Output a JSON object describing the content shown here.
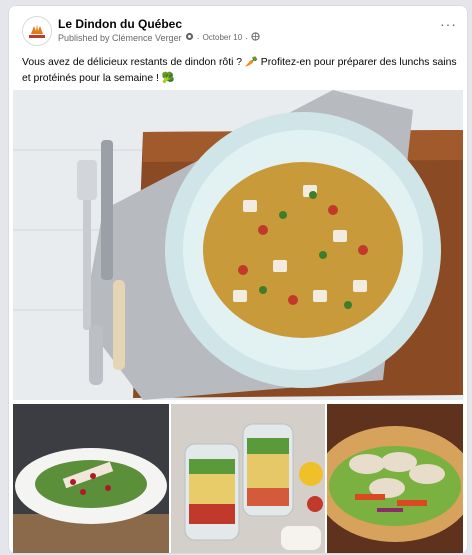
{
  "post": {
    "page_name": "Le Dindon du Québec",
    "published_by": "Published by Clémence Verger",
    "separator": "·",
    "date": "October 10",
    "caption": "Vous avez de délicieux restants de dindon rôti ? 🥕 Profitez-en pour préparer des lunchs sains et protéinés pour la semaine ! 🥦",
    "more_label": "···"
  },
  "avatar": {
    "logo_text": "Le Dindon du Québec"
  },
  "icons": {
    "avatar": "turkey-logo-icon",
    "gear": "gear-icon",
    "globe": "globe-icon",
    "more": "more-options-icon"
  },
  "colors": {
    "text_primary": "#050505",
    "text_secondary": "#65676b",
    "card_bg": "#ffffff",
    "page_bg": "#e4e6eb"
  }
}
